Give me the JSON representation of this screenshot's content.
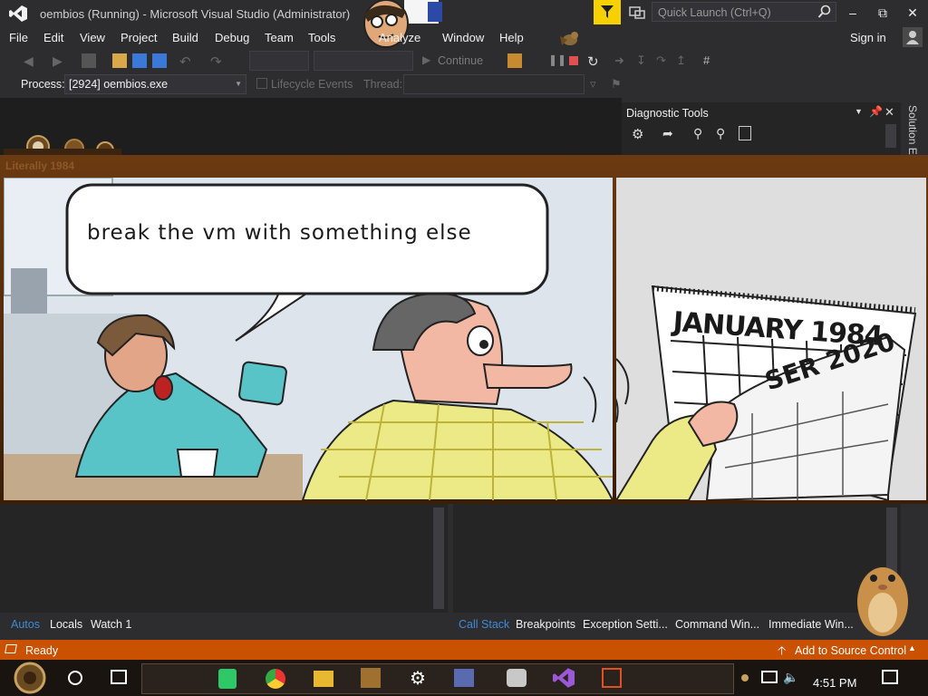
{
  "titlebar": {
    "title": "oembios (Running) - Microsoft Visual Studio  (Administrator)",
    "quick_launch_placeholder": "Quick Launch (Ctrl+Q)"
  },
  "menu": {
    "items": [
      "File",
      "Edit",
      "View",
      "Project",
      "Build",
      "Debug",
      "Team",
      "Tools",
      "Analyze",
      "Window",
      "Help"
    ],
    "sign_in": "Sign in"
  },
  "toolbar": {
    "continue_label": "Continue"
  },
  "process_bar": {
    "process_label": "Process:",
    "process_value": "[2924] oembios.exe",
    "lifecycle_label": "Lifecycle Events",
    "thread_label": "Thread:"
  },
  "diagnostic_tools": {
    "title": "Diagnostic Tools"
  },
  "solution_explorer": {
    "tab_label": "Solution Ex"
  },
  "comic": {
    "caption": "Literally 1984",
    "speech_bubble": "break the vm with something else",
    "calendar_top": "JANUARY 1984",
    "calendar_back": "SER 2020"
  },
  "bottom_left_tabs": [
    "Autos",
    "Locals",
    "Watch 1"
  ],
  "bottom_right_tabs": [
    "Call Stack",
    "Breakpoints",
    "Exception Setti...",
    "Command Win...",
    "Immediate Win..."
  ],
  "statusbar": {
    "ready": "Ready",
    "source_control": "Add to Source Control"
  },
  "taskbar": {
    "clock": "4:51 PM"
  },
  "colors": {
    "statusbar": "#ca5100",
    "accent_tab": "#3e8ad6",
    "filter_button": "#f7d000"
  }
}
